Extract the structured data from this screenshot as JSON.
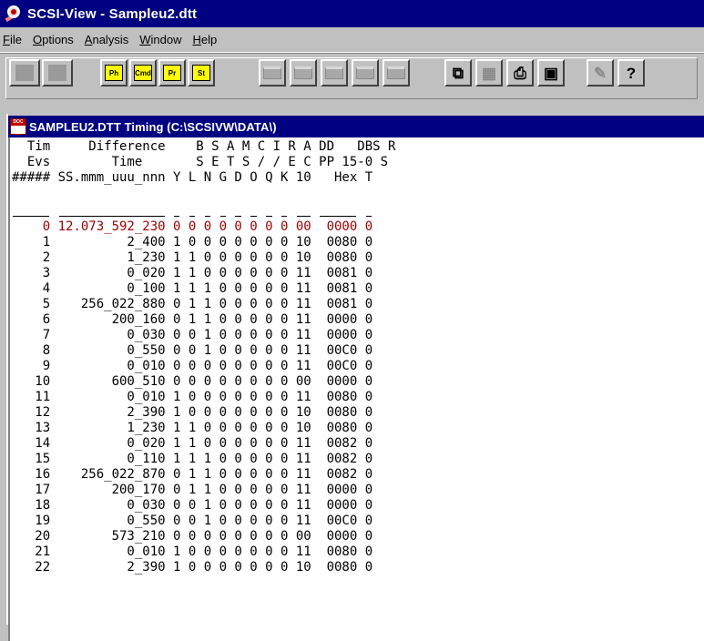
{
  "window": {
    "title": "SCSI-View - Sampleu2.dtt"
  },
  "menu": [
    {
      "label": "File",
      "ul": "F",
      "rest": "ile"
    },
    {
      "label": "Options",
      "ul": "O",
      "rest": "ptions"
    },
    {
      "label": "Analysis",
      "ul": "A",
      "rest": "nalysis"
    },
    {
      "label": "Window",
      "ul": "W",
      "rest": "indow"
    },
    {
      "label": "Help",
      "ul": "H",
      "rest": "elp"
    }
  ],
  "toolbar": {
    "icons": [
      "blank-button",
      "blank-button",
      "phs-icon",
      "cmd-icon",
      "prs-icon",
      "stat-icon",
      "disabled-icon",
      "disabled-icon",
      "disabled-icon",
      "disabled-icon",
      "disabled-icon",
      "copy-icon",
      "chart-icon",
      "print-icon",
      "preview-icon",
      "find-icon",
      "help-icon"
    ],
    "labels": {
      "phs": "Ph",
      "cmd": "Cmd",
      "prs": "Pr",
      "stat": "St"
    }
  },
  "document": {
    "title": "SAMPLEU2.DTT Timing (C:\\SCSIVW\\DATA\\)",
    "icon_label": "DOC"
  },
  "table": {
    "headers": [
      "  Tim     Difference    B S A M C I R A DD   DBS R",
      "  Evs        Time       S E T S / / E C PP 15-0 S",
      "##### SS.mmm_uuu_nnn Y L N G D O Q K 10   Hex T"
    ],
    "rows": [
      {
        "evs": "0",
        "time": "12.073_592_230",
        "bits": "0 0 0 0 0 0 0 0",
        "dp": "00",
        "dbs": "0000",
        "rst": "0",
        "red": true
      },
      {
        "evs": "1",
        "time": "2_400",
        "bits": "1 0 0 0 0 0 0 0",
        "dp": "10",
        "dbs": "0080",
        "rst": "0"
      },
      {
        "evs": "2",
        "time": "1_230",
        "bits": "1 1 0 0 0 0 0 0",
        "dp": "10",
        "dbs": "0080",
        "rst": "0"
      },
      {
        "evs": "3",
        "time": "0_020",
        "bits": "1 1 0 0 0 0 0 0",
        "dp": "11",
        "dbs": "0081",
        "rst": "0"
      },
      {
        "evs": "4",
        "time": "0_100",
        "bits": "1 1 1 0 0 0 0 0",
        "dp": "11",
        "dbs": "0081",
        "rst": "0"
      },
      {
        "evs": "5",
        "time": "256_022_880",
        "bits": "0 1 1 0 0 0 0 0",
        "dp": "11",
        "dbs": "0081",
        "rst": "0"
      },
      {
        "evs": "6",
        "time": "200_160",
        "bits": "0 1 1 0 0 0 0 0",
        "dp": "11",
        "dbs": "0000",
        "rst": "0"
      },
      {
        "evs": "7",
        "time": "0_030",
        "bits": "0 0 1 0 0 0 0 0",
        "dp": "11",
        "dbs": "0000",
        "rst": "0"
      },
      {
        "evs": "8",
        "time": "0_550",
        "bits": "0 0 1 0 0 0 0 0",
        "dp": "11",
        "dbs": "00C0",
        "rst": "0"
      },
      {
        "evs": "9",
        "time": "0_010",
        "bits": "0 0 0 0 0 0 0 0",
        "dp": "11",
        "dbs": "00C0",
        "rst": "0"
      },
      {
        "evs": "10",
        "time": "600_510",
        "bits": "0 0 0 0 0 0 0 0",
        "dp": "00",
        "dbs": "0000",
        "rst": "0"
      },
      {
        "evs": "11",
        "time": "0_010",
        "bits": "1 0 0 0 0 0 0 0",
        "dp": "11",
        "dbs": "0080",
        "rst": "0"
      },
      {
        "evs": "12",
        "time": "2_390",
        "bits": "1 0 0 0 0 0 0 0",
        "dp": "10",
        "dbs": "0080",
        "rst": "0"
      },
      {
        "evs": "13",
        "time": "1_230",
        "bits": "1 1 0 0 0 0 0 0",
        "dp": "10",
        "dbs": "0080",
        "rst": "0"
      },
      {
        "evs": "14",
        "time": "0_020",
        "bits": "1 1 0 0 0 0 0 0",
        "dp": "11",
        "dbs": "0082",
        "rst": "0"
      },
      {
        "evs": "15",
        "time": "0_110",
        "bits": "1 1 1 0 0 0 0 0",
        "dp": "11",
        "dbs": "0082",
        "rst": "0"
      },
      {
        "evs": "16",
        "time": "256_022_870",
        "bits": "0 1 1 0 0 0 0 0",
        "dp": "11",
        "dbs": "0082",
        "rst": "0"
      },
      {
        "evs": "17",
        "time": "200_170",
        "bits": "0 1 1 0 0 0 0 0",
        "dp": "11",
        "dbs": "0000",
        "rst": "0"
      },
      {
        "evs": "18",
        "time": "0_030",
        "bits": "0 0 1 0 0 0 0 0",
        "dp": "11",
        "dbs": "0000",
        "rst": "0"
      },
      {
        "evs": "19",
        "time": "0_550",
        "bits": "0 0 1 0 0 0 0 0",
        "dp": "11",
        "dbs": "00C0",
        "rst": "0"
      },
      {
        "evs": "20",
        "time": "573_210",
        "bits": "0 0 0 0 0 0 0 0",
        "dp": "00",
        "dbs": "0000",
        "rst": "0"
      },
      {
        "evs": "21",
        "time": "0_010",
        "bits": "1 0 0 0 0 0 0 0",
        "dp": "11",
        "dbs": "0080",
        "rst": "0"
      },
      {
        "evs": "22",
        "time": "2_390",
        "bits": "1 0 0 0 0 0 0 0",
        "dp": "10",
        "dbs": "0080",
        "rst": "0"
      }
    ]
  },
  "colors": {
    "titlebar": "#000080",
    "first_row": "#9a0000"
  }
}
